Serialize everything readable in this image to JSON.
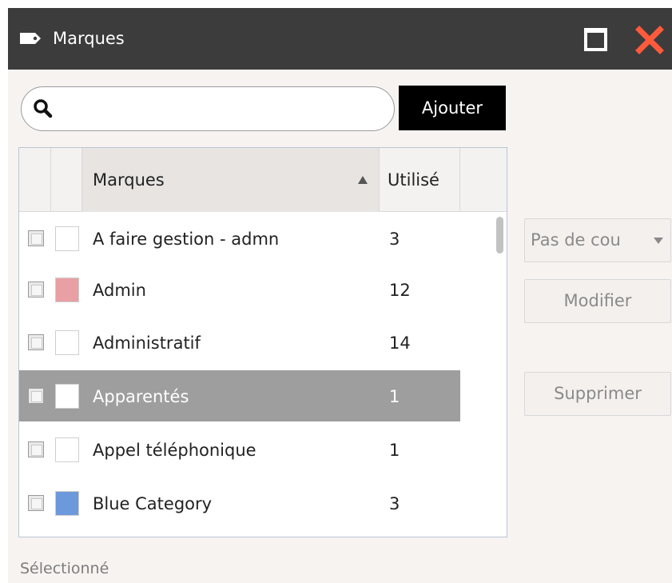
{
  "window": {
    "title": "Marques",
    "icon": "tag-icon",
    "maximize_icon": "maximize-icon",
    "close_icon": "close-icon",
    "close_color": "#ff5a3c"
  },
  "search": {
    "icon": "search-icon",
    "value": "",
    "placeholder": ""
  },
  "toolbar": {
    "add_label": "Ajouter"
  },
  "grid": {
    "columns": {
      "name": "Marques",
      "used": "Utilisé"
    },
    "sort": {
      "column": "Marques",
      "direction": "ascending",
      "icon": "sort-ascending-icon"
    },
    "rows": [
      {
        "name": "A faire gestion - admn",
        "count": "3",
        "color": "#ffffff",
        "selected": false
      },
      {
        "name": "Admin",
        "count": "12",
        "color": "#e8a0a4",
        "selected": false
      },
      {
        "name": "Administratif",
        "count": "14",
        "color": "#ffffff",
        "selected": false
      },
      {
        "name": "Apparentés",
        "count": "1",
        "color": "#ffffff",
        "selected": true
      },
      {
        "name": "Appel téléphonique",
        "count": "1",
        "color": "#ffffff",
        "selected": false
      },
      {
        "name": "Blue Category",
        "count": "3",
        "color": "#6c98dc",
        "selected": false
      }
    ],
    "selected_row_color": "#9e9e9e"
  },
  "actions": {
    "color_select_value": "Pas de cou",
    "modify_label": "Modifier",
    "delete_label": "Supprimer"
  },
  "sections": {
    "selected_label": "Sélectionné"
  }
}
